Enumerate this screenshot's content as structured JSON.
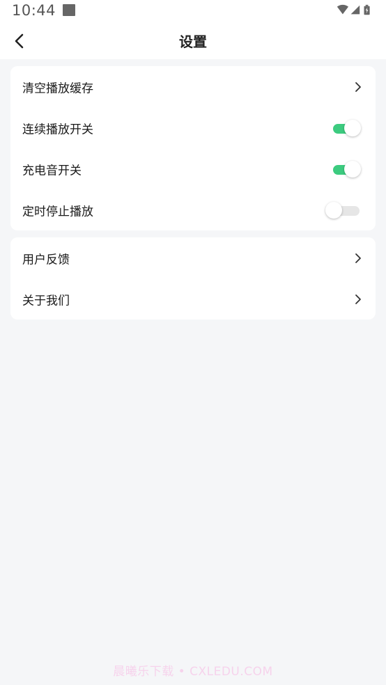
{
  "status_bar": {
    "time": "10:44",
    "icons": [
      "notification-square-icon",
      "wifi-icon",
      "signal-icon",
      "battery-icon"
    ]
  },
  "header": {
    "title": "设置",
    "back_icon": "chevron-left-icon"
  },
  "settings": {
    "group1": [
      {
        "label": "清空播放缓存",
        "control": "chevron"
      },
      {
        "label": "连续播放开关",
        "control": "toggle",
        "on": true
      },
      {
        "label": "充电音开关",
        "control": "toggle",
        "on": true
      },
      {
        "label": "定时停止播放",
        "control": "toggle",
        "on": false
      }
    ],
    "group2": [
      {
        "label": "用户反馈",
        "control": "chevron"
      },
      {
        "label": "关于我们",
        "control": "chevron"
      }
    ]
  },
  "colors": {
    "toggle_on": "#3ccb7f",
    "toggle_off": "#e6e6e6",
    "page_background": "#f5f6f8"
  },
  "watermark": "晨曦乐下载 • CXLEDU.COM"
}
